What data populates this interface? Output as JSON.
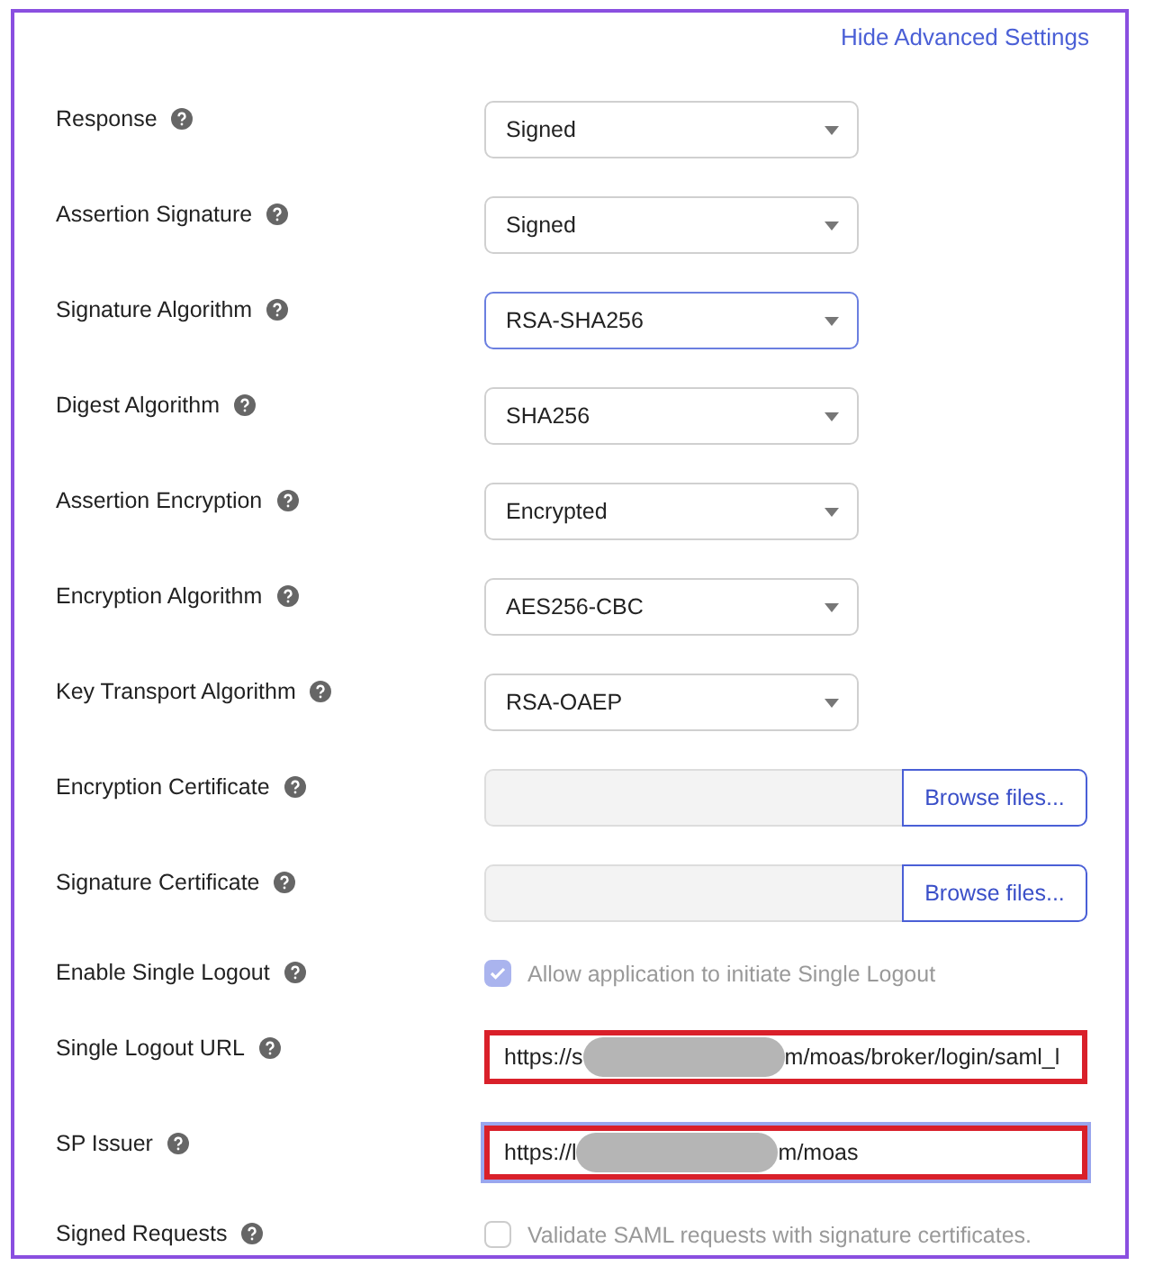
{
  "advanced_toggle": {
    "label": "Hide Advanced Settings"
  },
  "settings": [
    {
      "kind": "select",
      "label": "Response",
      "value": "Signed",
      "focused": false
    },
    {
      "kind": "select",
      "label": "Assertion Signature",
      "value": "Signed",
      "focused": false
    },
    {
      "kind": "select",
      "label": "Signature Algorithm",
      "value": "RSA-SHA256",
      "focused": true
    },
    {
      "kind": "select",
      "label": "Digest Algorithm",
      "value": "SHA256",
      "focused": false
    },
    {
      "kind": "select",
      "label": "Assertion Encryption",
      "value": "Encrypted",
      "focused": false
    },
    {
      "kind": "select",
      "label": "Encryption Algorithm",
      "value": "AES256-CBC",
      "focused": false
    },
    {
      "kind": "select",
      "label": "Key Transport Algorithm",
      "value": "RSA-OAEP",
      "focused": false
    },
    {
      "kind": "file",
      "label": "Encryption Certificate",
      "button": "Browse files..."
    },
    {
      "kind": "file",
      "label": "Signature Certificate",
      "button": "Browse files..."
    },
    {
      "kind": "checkbox",
      "label": "Enable Single Logout",
      "text": "Allow application to initiate Single Logout",
      "checked": true,
      "disabled": true
    },
    {
      "kind": "text",
      "label": "Single Logout URL",
      "value_start": "https://s",
      "value_end": "m/moas/broker/login/saml_l",
      "focused": false,
      "highlighted": true
    },
    {
      "kind": "text",
      "label": "SP Issuer",
      "value_start": "https://l",
      "value_end": "m/moas",
      "focused": true,
      "highlighted": true
    },
    {
      "kind": "checkbox",
      "label": "Signed Requests",
      "text": "Validate SAML requests with signature certificates.",
      "checked": false,
      "disabled": true
    }
  ]
}
